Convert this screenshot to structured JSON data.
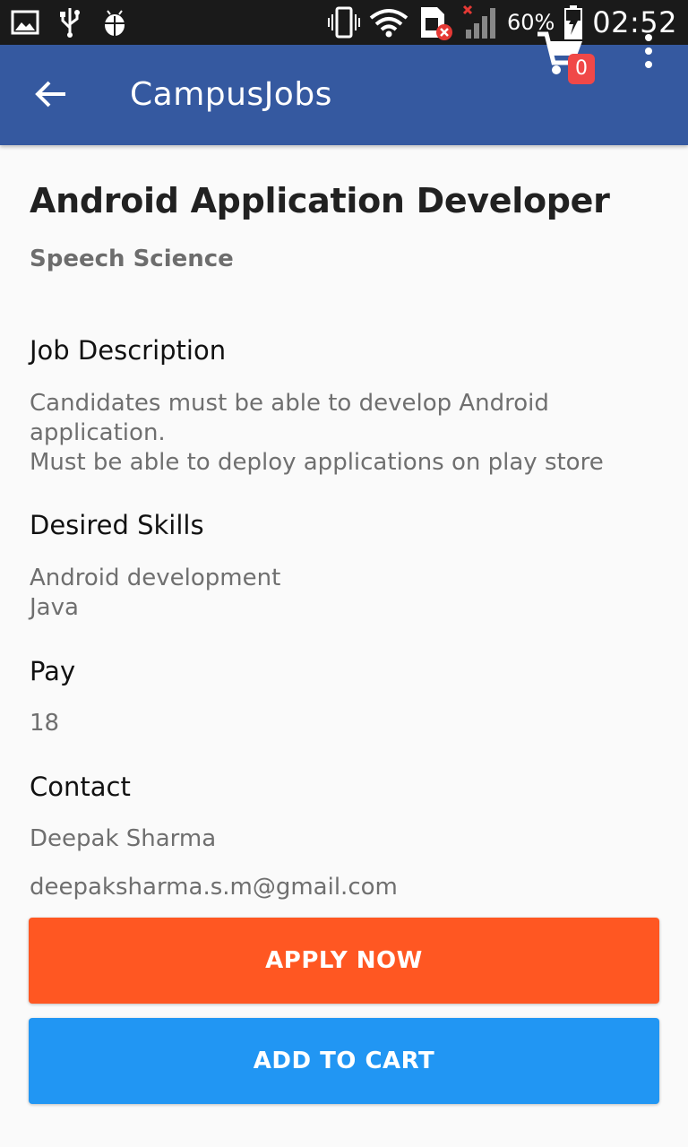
{
  "status_bar": {
    "battery_percent": "60%",
    "time": "02:52"
  },
  "app_bar": {
    "title": "CampusJobs",
    "cart_count": "0"
  },
  "job": {
    "title": "Android Application Developer",
    "company": "Speech Science",
    "description_heading": "Job Description",
    "description_lines": [
      "Candidates must be able to develop Android",
      "application.",
      "Must be able to deploy applications on play store"
    ],
    "skills_heading": "Desired Skills",
    "skills": [
      "Android development",
      "Java"
    ],
    "pay_heading": "Pay",
    "pay": "18",
    "contact_heading": "Contact",
    "contact_name": "Deepak Sharma",
    "contact_email": "deepaksharma.s.m@gmail.com"
  },
  "actions": {
    "apply_label": "APPLY NOW",
    "cart_label": "ADD TO CART"
  },
  "colors": {
    "app_bar": "#3559a0",
    "apply_button": "#ff5722",
    "cart_button": "#2196f3",
    "badge": "#f04848"
  },
  "icons": [
    "image-icon",
    "usb-icon",
    "android-debug-icon",
    "vibrate-icon",
    "wifi-icon",
    "sim-error-icon",
    "signal-icon",
    "battery-charging-icon",
    "back-arrow-icon",
    "cart-icon",
    "overflow-menu-icon"
  ]
}
